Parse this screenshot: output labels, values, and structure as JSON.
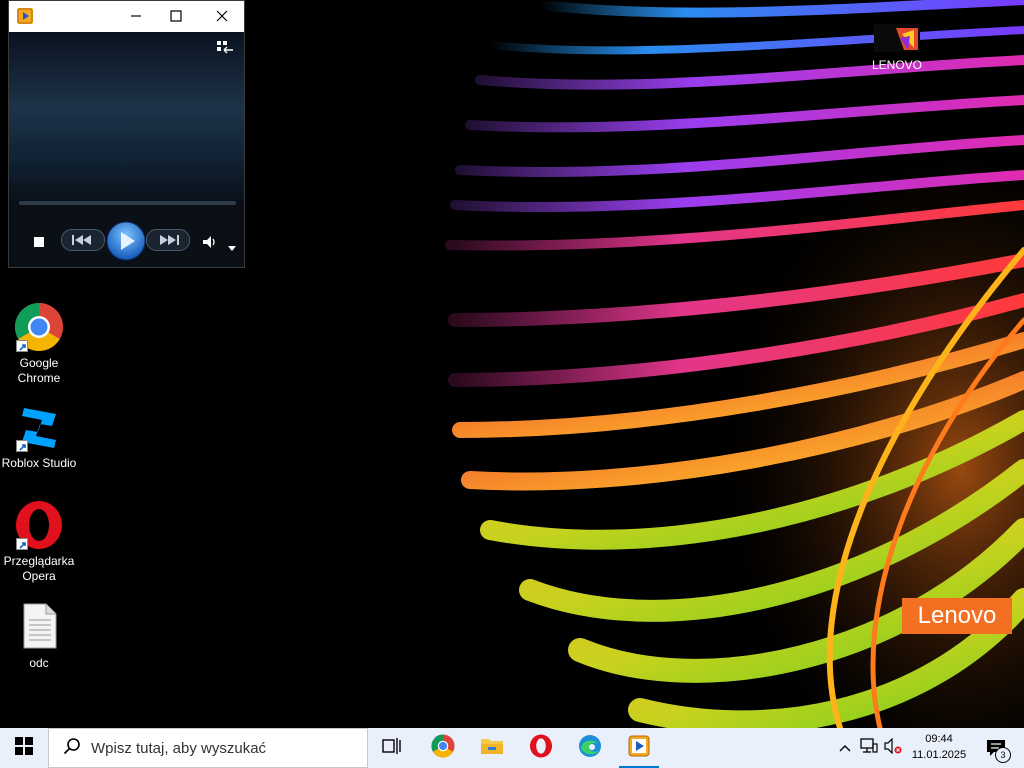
{
  "desktop": {
    "icons": [
      {
        "label": "Google\nChrome",
        "icon": "chrome-icon"
      },
      {
        "label": "Roblox Studio",
        "icon": "roblox-studio-icon"
      },
      {
        "label": "Przeglądarka\nOpera",
        "icon": "opera-icon"
      },
      {
        "label": "odc",
        "icon": "text-file-icon"
      }
    ],
    "lenovo_item": {
      "label": "LENOVO",
      "icon": "folder-thumbnail-icon"
    },
    "wallpaper_brand": "Lenovo"
  },
  "media_player": {
    "title": "",
    "title_buttons": [
      "minimize-icon",
      "maximize-icon",
      "close-icon"
    ],
    "switch_library_icon": "switch-to-library-icon",
    "controls": [
      "stop-icon",
      "previous-icon",
      "play-icon",
      "next-icon",
      "volume-icon",
      "volume-dropdown-icon"
    ],
    "seek_progress": 0
  },
  "taskbar": {
    "search_placeholder": "Wpisz tutaj, aby wyszukać",
    "pinned": [
      "task-view-icon",
      "chrome-icon",
      "file-explorer-icon",
      "opera-icon",
      "edge-icon",
      "media-player-icon"
    ],
    "active_app": "media-player-icon",
    "tray_icons": [
      "show-hidden-icons-icon",
      "network-icon",
      "volume-muted-icon"
    ],
    "time": "09:44",
    "date": "11.01.2025",
    "notification_count": "3"
  },
  "colors": {
    "taskbar_bg": "#e9f0fb",
    "lenovo_orange": "#f36f21",
    "active_indicator": "#0078d7"
  }
}
